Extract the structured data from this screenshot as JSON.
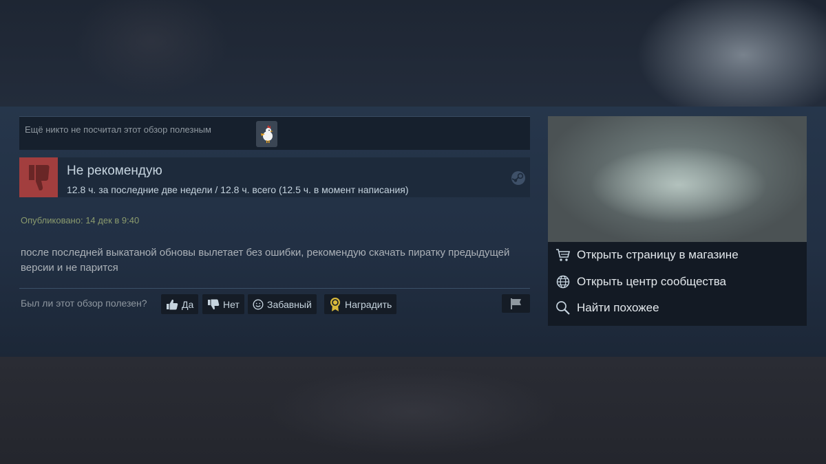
{
  "review": {
    "votes_text": "Ещё никто не посчитал этот обзор полезным",
    "verdict": "Не рекомендую",
    "hours": "12.8 ч. за последние две недели / 12.8 ч. всего (12.5 ч. в момент написания)",
    "posted": "Опубликовано: 14 дек в 9:40",
    "body": "после последней выкатаной обновы вылетает без ошибки, рекомендую скачать пиратку предыдущей версии и не парится"
  },
  "feedback": {
    "question": "Был ли этот обзор полезен?",
    "yes_label": "Да",
    "no_label": "Нет",
    "funny_label": "Забавный",
    "award_label": "Наградить"
  },
  "sidebar": {
    "links": [
      {
        "label": "Открыть страницу в магазине",
        "icon": "cart-icon"
      },
      {
        "label": "Открыть центр сообщества",
        "icon": "globe-icon"
      },
      {
        "label": "Найти похожее",
        "icon": "search-icon"
      }
    ]
  },
  "colors": {
    "negative": "#a23e3e",
    "posted_text": "#8b9b6e",
    "band_bg": "#223044",
    "award_gold": "#d8b93a"
  }
}
